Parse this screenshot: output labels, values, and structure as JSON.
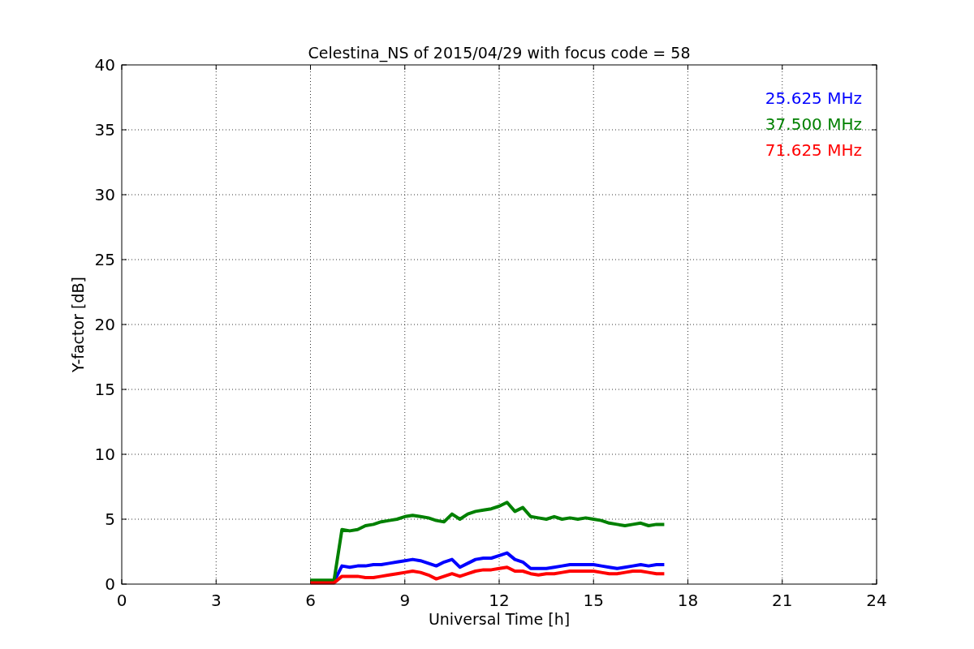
{
  "chart_data": {
    "type": "line",
    "title": "Celestina_NS of 2015/04/29 with focus code = 58",
    "xlabel": "Universal Time [h]",
    "ylabel": "Y-factor [dB]",
    "x": [
      6,
      6.25,
      6.5,
      6.75,
      7,
      7.25,
      7.5,
      7.75,
      8,
      8.25,
      8.5,
      8.75,
      9,
      9.25,
      9.5,
      9.75,
      10,
      10.25,
      10.5,
      10.75,
      11,
      11.25,
      11.5,
      11.75,
      12,
      12.25,
      12.5,
      12.75,
      13,
      13.25,
      13.5,
      13.75,
      14,
      14.25,
      14.5,
      14.75,
      15,
      15.25,
      15.5,
      15.75,
      16,
      16.25,
      16.5,
      16.75,
      17,
      17.25
    ],
    "series": [
      {
        "name": "25.625 MHz",
        "color": "#0000ff",
        "values": [
          null,
          null,
          null,
          0.2,
          1.4,
          1.3,
          1.4,
          1.4,
          1.5,
          1.5,
          1.6,
          1.7,
          1.8,
          1.9,
          1.8,
          1.6,
          1.4,
          1.7,
          1.9,
          1.3,
          1.6,
          1.9,
          2.0,
          2.0,
          2.2,
          2.4,
          1.9,
          1.7,
          1.2,
          1.2,
          1.2,
          1.3,
          1.4,
          1.5,
          1.5,
          1.5,
          1.5,
          1.4,
          1.3,
          1.2,
          1.3,
          1.4,
          1.5,
          1.4,
          1.5,
          1.5
        ]
      },
      {
        "name": "37.500 MHz",
        "color": "#008000",
        "values": [
          0.3,
          0.3,
          0.3,
          0.3,
          4.2,
          4.1,
          4.2,
          4.5,
          4.6,
          4.8,
          4.9,
          5.0,
          5.2,
          5.3,
          5.2,
          5.1,
          4.9,
          4.8,
          5.4,
          5.0,
          5.4,
          5.6,
          5.7,
          5.8,
          6.0,
          6.3,
          5.6,
          5.9,
          5.2,
          5.1,
          5.0,
          5.2,
          5.0,
          5.1,
          5.0,
          5.1,
          5.0,
          4.9,
          4.7,
          4.6,
          4.5,
          4.6,
          4.7,
          4.5,
          4.6,
          4.6
        ]
      },
      {
        "name": "71.625 MHz",
        "color": "#ff0000",
        "values": [
          0.1,
          0.1,
          0.1,
          0.1,
          0.6,
          0.6,
          0.6,
          0.5,
          0.5,
          0.6,
          0.7,
          0.8,
          0.9,
          1.0,
          0.9,
          0.7,
          0.4,
          0.6,
          0.8,
          0.6,
          0.8,
          1.0,
          1.1,
          1.1,
          1.2,
          1.3,
          1.0,
          1.0,
          0.8,
          0.7,
          0.8,
          0.8,
          0.9,
          1.0,
          1.0,
          1.0,
          1.0,
          0.9,
          0.8,
          0.8,
          0.9,
          1.0,
          1.0,
          0.9,
          0.8,
          0.8
        ]
      }
    ],
    "grid": true,
    "xlim": [
      0,
      24
    ],
    "ylim": [
      0,
      40
    ],
    "xticks": [
      0,
      3,
      6,
      9,
      12,
      15,
      18,
      21,
      24
    ],
    "yticks": [
      0,
      5,
      10,
      15,
      20,
      25,
      30,
      35,
      40
    ]
  }
}
